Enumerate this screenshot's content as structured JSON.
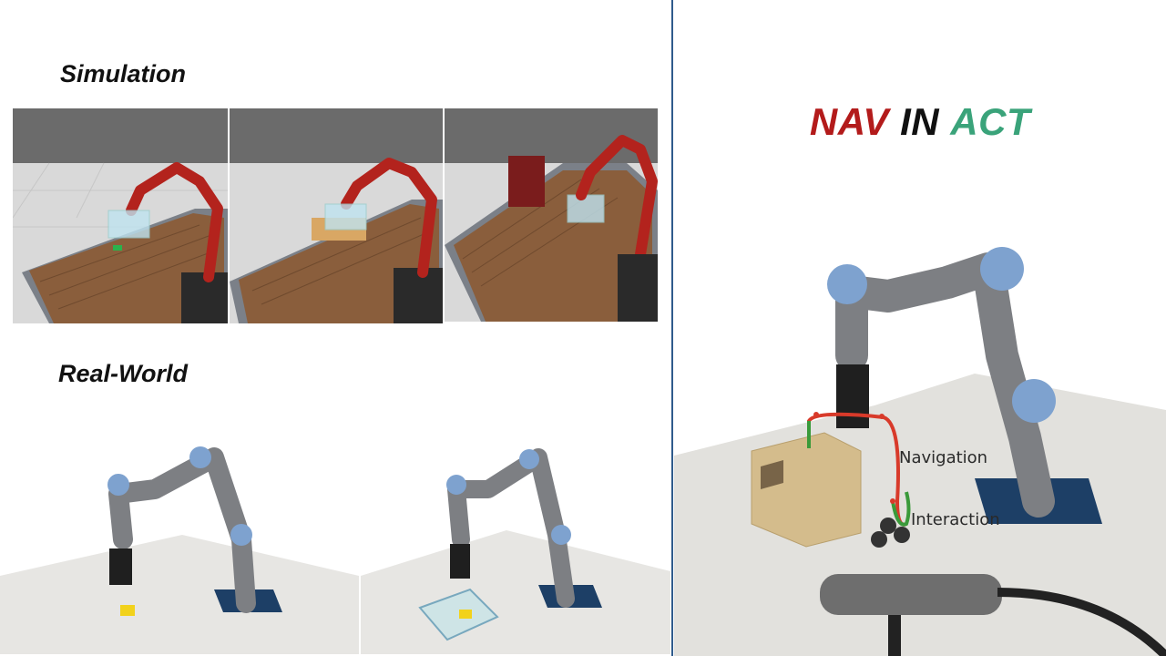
{
  "sections": {
    "simulation": "Simulation",
    "real_world": "Real-World"
  },
  "title": {
    "part1": "NAV",
    "part2": "IN",
    "part3": "ACT",
    "colors": {
      "nav": "#b31b1b",
      "in": "#111111",
      "act": "#3aa37a"
    }
  },
  "annotations": {
    "navigation": "Navigation",
    "interaction": "Interaction"
  },
  "colors": {
    "divider": "#2f5b8c",
    "sim_robot": "#b3231d",
    "navigation_path": "#d83a2a",
    "interaction_path": "#3a9a3a"
  }
}
